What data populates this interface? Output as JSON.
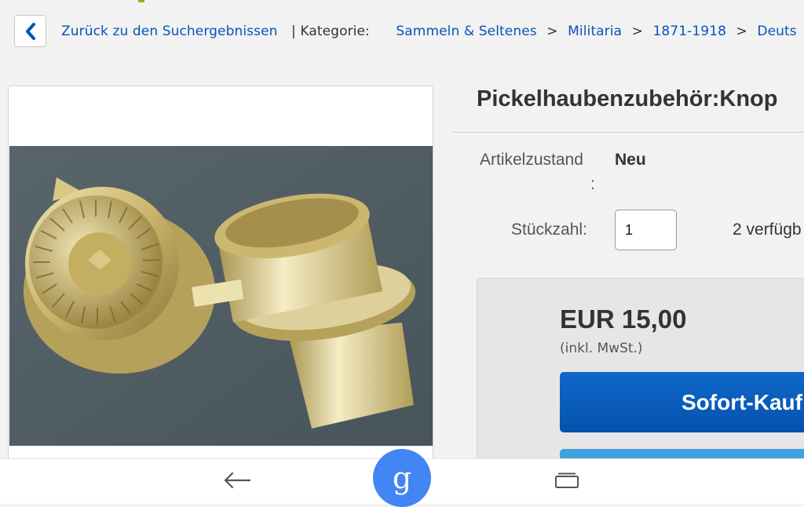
{
  "breadcrumb": {
    "back_label": "Zurück zu den Suchergebnissen",
    "pipe": "|",
    "category_label": "Kategorie:",
    "separator": ">",
    "items": [
      "Sammeln & Seltenes",
      "Militaria",
      "1871-1918",
      "Deuts"
    ]
  },
  "item": {
    "title": "Pickelhaubenzubehör:Knop"
  },
  "details": {
    "condition_label": "Artikelzustand",
    "condition_colon": ":",
    "condition_value": "Neu",
    "quantity_label": "Stückzahl:",
    "quantity_value": "1",
    "available": "2 verfügb"
  },
  "purchase": {
    "price": "EUR 15,00",
    "tax_note": "(inkl. MwSt.)",
    "buy_now_label": "Sofort-Kauf"
  },
  "navbar": {
    "google_glyph": "g"
  },
  "colors": {
    "link": "#0654ba",
    "buy_button": "#0654ba",
    "secondary_button": "#3fa1de",
    "google": "#4285f4"
  },
  "icons": [
    "chevron-left-icon",
    "arrow-back-icon",
    "google-icon",
    "recents-icon"
  ]
}
